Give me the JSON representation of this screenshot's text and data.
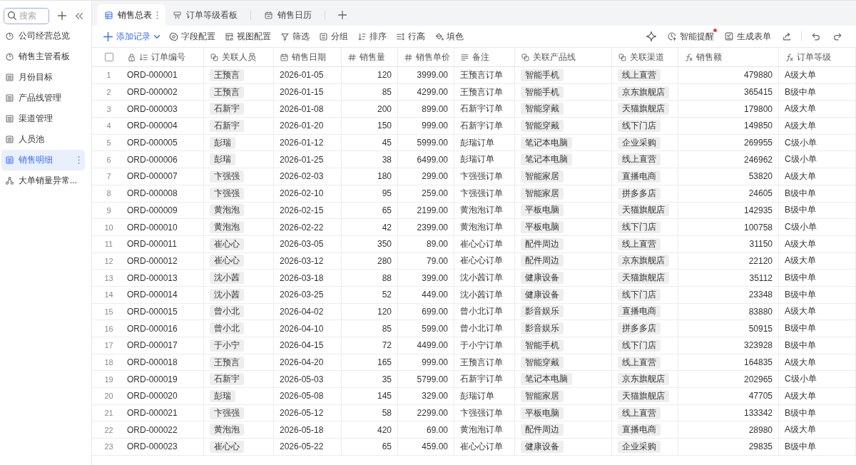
{
  "sidebar": {
    "search": {
      "placeholder": "搜索"
    },
    "items": [
      {
        "label": "公司经营总览",
        "kind": "dashboard",
        "selected": false
      },
      {
        "label": "销售主管看板",
        "kind": "dashboard",
        "selected": false
      },
      {
        "label": "月份目标",
        "kind": "table",
        "selected": false
      },
      {
        "label": "产品线管理",
        "kind": "table",
        "selected": false
      },
      {
        "label": "渠道管理",
        "kind": "table",
        "selected": false
      },
      {
        "label": "人员池",
        "kind": "table",
        "selected": false
      },
      {
        "label": "销售明细",
        "kind": "table",
        "selected": true
      },
      {
        "label": "大单销量异常...",
        "kind": "workflow",
        "selected": false
      }
    ]
  },
  "tabs": [
    {
      "label": "销售总表",
      "kind": "grid",
      "selected": true
    },
    {
      "label": "订单等级看板",
      "kind": "kanban",
      "selected": false
    },
    {
      "label": "销售日历",
      "kind": "calendar",
      "selected": false
    }
  ],
  "toolbar": {
    "left": [
      {
        "label": "添加记录",
        "kind": "add"
      },
      {
        "label": "字段配置",
        "kind": "fields"
      },
      {
        "label": "视图配置",
        "kind": "view"
      },
      {
        "label": "筛选",
        "kind": "filter"
      },
      {
        "label": "分组",
        "kind": "group"
      },
      {
        "label": "排序",
        "kind": "sort"
      },
      {
        "label": "行高",
        "kind": "row-height"
      },
      {
        "label": "填色",
        "kind": "fill"
      }
    ],
    "right": [
      {
        "kind": "ai"
      },
      {
        "label": "智能提醒",
        "kind": "reminder",
        "notify": true
      },
      {
        "label": "生成表单",
        "kind": "form"
      },
      {
        "kind": "share"
      },
      {
        "kind": "undo"
      },
      {
        "kind": "redo"
      }
    ]
  },
  "table": {
    "select_all": {
      "checked": false
    },
    "columns": [
      {
        "label": "订单编号",
        "kind": "autonumber",
        "locked": true
      },
      {
        "label": "关联人员",
        "kind": "link"
      },
      {
        "label": "销售日期",
        "kind": "date"
      },
      {
        "label": "销售量",
        "kind": "number"
      },
      {
        "label": "销售单价",
        "kind": "number"
      },
      {
        "label": "备注",
        "kind": "text"
      },
      {
        "label": "关联产品线",
        "kind": "link"
      },
      {
        "label": "关联渠道",
        "kind": "link"
      },
      {
        "label": "销售额",
        "kind": "formula",
        "numeric": true
      },
      {
        "label": "订单等级",
        "kind": "formula",
        "numeric": false
      }
    ],
    "rows": [
      {
        "number": "1",
        "cells": [
          "ORD-000001",
          "王预言",
          "2026-01-05",
          "120",
          "3999.00",
          "王预言订单",
          "智能手机",
          "线上直营",
          "479880",
          "A级大单"
        ]
      },
      {
        "number": "2",
        "cells": [
          "ORD-000002",
          "王预言",
          "2026-01-15",
          "85",
          "4299.00",
          "王预言订单",
          "智能手机",
          "京东旗舰店",
          "365415",
          "B级中单"
        ]
      },
      {
        "number": "3",
        "cells": [
          "ORD-000003",
          "石新宇",
          "2026-01-08",
          "200",
          "899.00",
          "石新宇订单",
          "智能穿戴",
          "天猫旗舰店",
          "179800",
          "A级大单"
        ]
      },
      {
        "number": "4",
        "cells": [
          "ORD-000004",
          "石新宇",
          "2026-01-20",
          "150",
          "999.00",
          "石新宇订单",
          "智能穿戴",
          "线下门店",
          "149850",
          "A级大单"
        ]
      },
      {
        "number": "5",
        "cells": [
          "ORD-000005",
          "彭瑞",
          "2026-01-12",
          "45",
          "5999.00",
          "彭瑞订单",
          "笔记本电脑",
          "企业采购",
          "269955",
          "C级小单"
        ]
      },
      {
        "number": "6",
        "cells": [
          "ORD-000006",
          "彭瑞",
          "2026-01-25",
          "38",
          "6499.00",
          "彭瑞订单",
          "笔记本电脑",
          "线上直营",
          "246962",
          "C级小单"
        ]
      },
      {
        "number": "7",
        "cells": [
          "ORD-000007",
          "卞强强",
          "2026-02-03",
          "180",
          "299.00",
          "卞强强订单",
          "智能家居",
          "直播电商",
          "53820",
          "A级大单"
        ]
      },
      {
        "number": "8",
        "cells": [
          "ORD-000008",
          "卞强强",
          "2026-02-10",
          "95",
          "259.00",
          "卞强强订单",
          "智能家居",
          "拼多多店",
          "24605",
          "B级中单"
        ]
      },
      {
        "number": "9",
        "cells": [
          "ORD-000009",
          "黄泡泡",
          "2026-02-15",
          "65",
          "2199.00",
          "黄泡泡订单",
          "平板电脑",
          "天猫旗舰店",
          "142935",
          "B级中单"
        ]
      },
      {
        "number": "10",
        "cells": [
          "ORD-000010",
          "黄泡泡",
          "2026-02-22",
          "42",
          "2399.00",
          "黄泡泡订单",
          "平板电脑",
          "线下门店",
          "100758",
          "C级小单"
        ]
      },
      {
        "number": "11",
        "cells": [
          "ORD-000011",
          "崔心心",
          "2026-03-05",
          "350",
          "89.00",
          "崔心心订单",
          "配件周边",
          "线上直营",
          "31150",
          "A级大单"
        ]
      },
      {
        "number": "12",
        "cells": [
          "ORD-000012",
          "崔心心",
          "2026-03-12",
          "280",
          "79.00",
          "崔心心订单",
          "配件周边",
          "京东旗舰店",
          "22120",
          "A级大单"
        ]
      },
      {
        "number": "13",
        "cells": [
          "ORD-000013",
          "沈小茜",
          "2026-03-18",
          "88",
          "399.00",
          "沈小茜订单",
          "健康设备",
          "天猫旗舰店",
          "35112",
          "B级中单"
        ]
      },
      {
        "number": "14",
        "cells": [
          "ORD-000014",
          "沈小茜",
          "2026-03-25",
          "52",
          "449.00",
          "沈小茜订单",
          "健康设备",
          "线下门店",
          "23348",
          "B级中单"
        ]
      },
      {
        "number": "15",
        "cells": [
          "ORD-000015",
          "曾小北",
          "2026-04-02",
          "120",
          "699.00",
          "曾小北订单",
          "影音娱乐",
          "直播电商",
          "83880",
          "A级大单"
        ]
      },
      {
        "number": "16",
        "cells": [
          "ORD-000016",
          "曾小北",
          "2026-04-10",
          "85",
          "599.00",
          "曾小北订单",
          "影音娱乐",
          "拼多多店",
          "50915",
          "B级中单"
        ]
      },
      {
        "number": "17",
        "cells": [
          "ORD-000017",
          "于小宁",
          "2026-04-15",
          "72",
          "4499.00",
          "于小宁订单",
          "智能手机",
          "线下门店",
          "323928",
          "B级中单"
        ]
      },
      {
        "number": "18",
        "cells": [
          "ORD-000018",
          "王预言",
          "2026-04-20",
          "165",
          "999.00",
          "王预言订单",
          "智能穿戴",
          "线上直营",
          "164835",
          "A级大单"
        ]
      },
      {
        "number": "19",
        "cells": [
          "ORD-000019",
          "石新宇",
          "2026-05-03",
          "35",
          "5799.00",
          "石新宇订单",
          "笔记本电脑",
          "京东旗舰店",
          "202965",
          "C级小单"
        ]
      },
      {
        "number": "20",
        "cells": [
          "ORD-000020",
          "彭瑞",
          "2026-05-08",
          "145",
          "329.00",
          "彭瑞订单",
          "智能家居",
          "天猫旗舰店",
          "47705",
          "A级大单"
        ]
      },
      {
        "number": "21",
        "cells": [
          "ORD-000021",
          "卞强强",
          "2026-05-12",
          "58",
          "2299.00",
          "卞强强订单",
          "平板电脑",
          "线上直营",
          "133342",
          "B级中单"
        ]
      },
      {
        "number": "22",
        "cells": [
          "ORD-000022",
          "黄泡泡",
          "2026-05-18",
          "420",
          "69.00",
          "黄泡泡订单",
          "配件周边",
          "直播电商",
          "28980",
          "A级大单"
        ]
      },
      {
        "number": "23",
        "cells": [
          "ORD-000023",
          "崔心心",
          "2026-05-22",
          "65",
          "459.00",
          "崔心心订单",
          "健康设备",
          "企业采购",
          "29835",
          "B级中单"
        ]
      }
    ]
  }
}
